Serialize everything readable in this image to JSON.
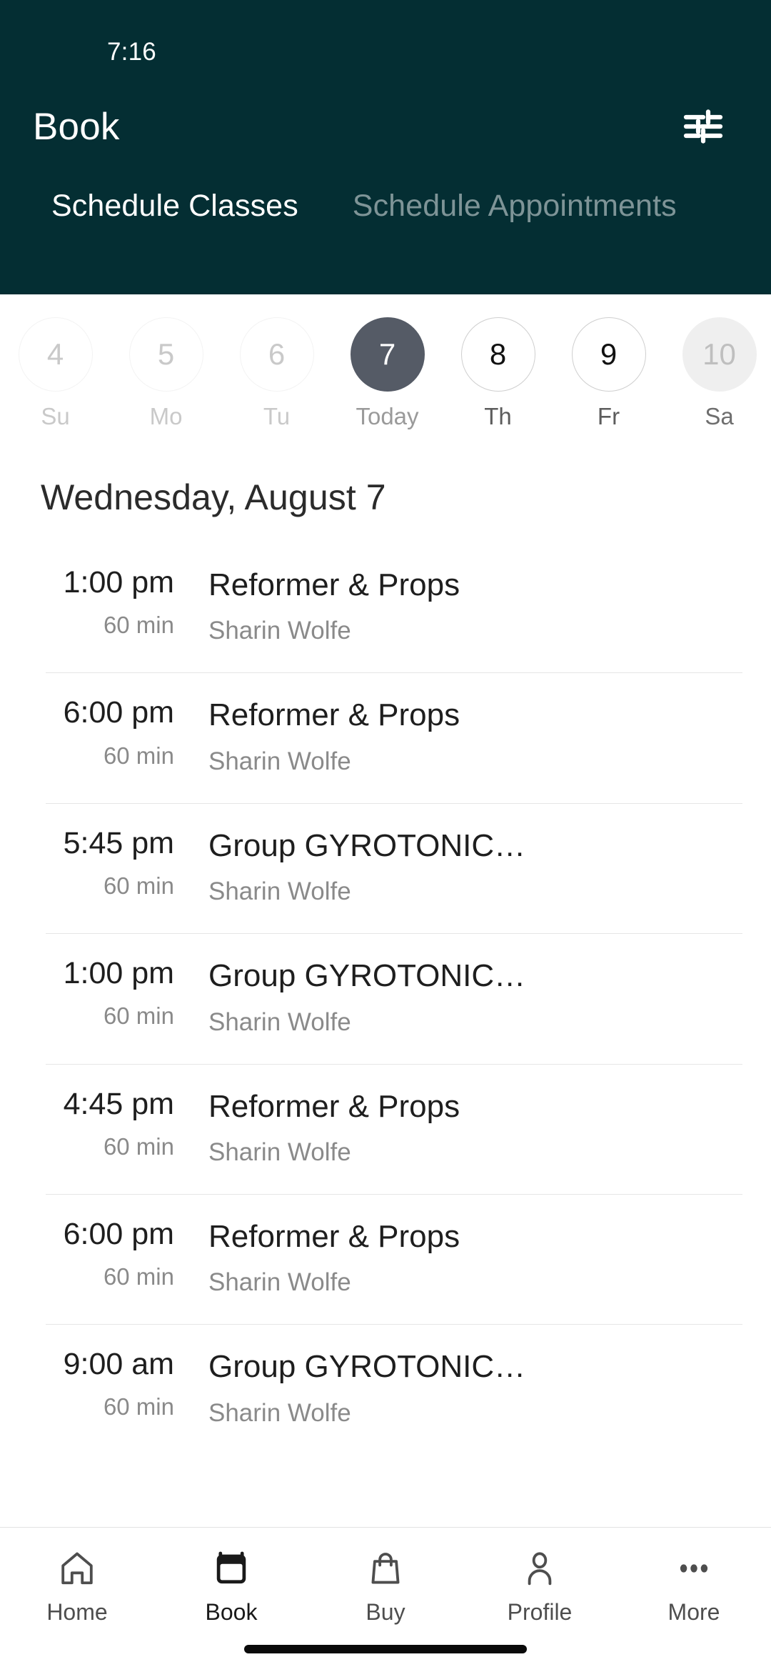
{
  "colors": {
    "header_bg": "#042E33",
    "header_text": "#FFFFFF",
    "tab_inactive": "#7E9497",
    "selected_day_bg": "#555B66",
    "shaded_day_bg": "#EFEFEF",
    "divider": "#E6E6E6",
    "muted_text": "#8A8A8A",
    "primary_text": "#1E1E1E"
  },
  "statusbar": {
    "clock": "7:16"
  },
  "header": {
    "title": "Book",
    "filter_icon": "sliders-filter-icon"
  },
  "tabs": [
    {
      "label": "Schedule Classes",
      "active": true
    },
    {
      "label": "Schedule Appointments",
      "active": false
    }
  ],
  "datestrip": [
    {
      "date": "4",
      "weekday": "Su",
      "state": "past"
    },
    {
      "date": "5",
      "weekday": "Mo",
      "state": "past"
    },
    {
      "date": "6",
      "weekday": "Tu",
      "state": "past"
    },
    {
      "date": "7",
      "weekday": "Today",
      "state": "selected"
    },
    {
      "date": "8",
      "weekday": "Th",
      "state": "normal"
    },
    {
      "date": "9",
      "weekday": "Fr",
      "state": "normal"
    },
    {
      "date": "10",
      "weekday": "Sa",
      "state": "shaded"
    }
  ],
  "day_heading": "Wednesday, August 7",
  "classes": [
    {
      "time": "1:00 pm",
      "duration": "60 min",
      "name": "Reformer & Props",
      "instructor": "Sharin Wolfe"
    },
    {
      "time": "6:00 pm",
      "duration": "60 min",
      "name": "Reformer & Props",
      "instructor": "Sharin Wolfe"
    },
    {
      "time": "5:45 pm",
      "duration": "60 min",
      "name": "Group GYROTONIC® To…",
      "instructor": "Sharin Wolfe"
    },
    {
      "time": "1:00 pm",
      "duration": "60 min",
      "name": "Group GYROTONIC® To…",
      "instructor": "Sharin Wolfe"
    },
    {
      "time": "4:45 pm",
      "duration": "60 min",
      "name": "Reformer & Props",
      "instructor": "Sharin Wolfe"
    },
    {
      "time": "6:00 pm",
      "duration": "60 min",
      "name": "Reformer & Props",
      "instructor": "Sharin Wolfe"
    },
    {
      "time": "9:00 am",
      "duration": "60 min",
      "name": "Group GYROTONIC® To…",
      "instructor": "Sharin Wolfe"
    }
  ],
  "bottomnav": [
    {
      "label": "Home",
      "icon": "home-icon",
      "active": false
    },
    {
      "label": "Book",
      "icon": "calendar-icon",
      "active": true
    },
    {
      "label": "Buy",
      "icon": "bag-icon",
      "active": false
    },
    {
      "label": "Profile",
      "icon": "person-icon",
      "active": false
    },
    {
      "label": "More",
      "icon": "ellipsis-icon",
      "active": false
    }
  ]
}
